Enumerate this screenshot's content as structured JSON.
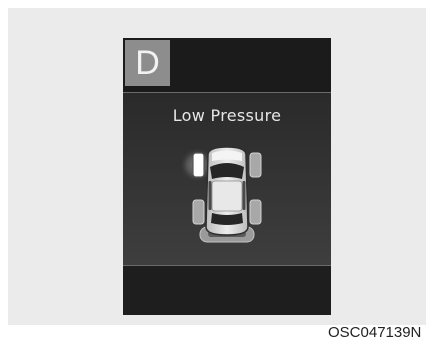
{
  "display": {
    "gear": "D",
    "warning_message": "Low Pressure"
  },
  "figure_code": "OSC047139N",
  "icons": {
    "gear_indicator": "gear-d-icon",
    "car": "car-top-view-icon",
    "warning_tire": "front-left-tire-warning-icon"
  },
  "colors": {
    "page_background": "#ebebeb",
    "display_background": "#1c1c1c",
    "gear_box": "#8d8d8d",
    "message_text": "#e6e6e6",
    "tire_warning": "#ffffff",
    "tire_normal": "#a8a8a8"
  }
}
